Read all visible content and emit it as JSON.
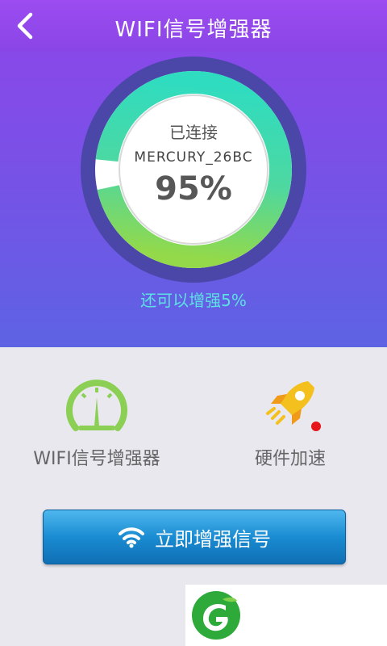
{
  "header": {
    "title": "WIFI信号增强器",
    "back_icon": "chevron-left-icon"
  },
  "gauge": {
    "status": "已连接",
    "ssid": "MERCURY_26BC",
    "percent_text": "95%",
    "percent_value": 95,
    "hint": "还可以增强5%"
  },
  "features": [
    {
      "label": "WIFI信号增强器",
      "icon": "speedometer-icon"
    },
    {
      "label": "硬件加速",
      "icon": "rocket-icon"
    }
  ],
  "action": {
    "label": "立即增强信号",
    "icon": "wifi-icon"
  },
  "colors": {
    "accent_green": "#8bd04b",
    "button_blue": "#1a8cd2",
    "hint_cyan": "#5ce1e4",
    "badge_red": "#e8141c"
  }
}
